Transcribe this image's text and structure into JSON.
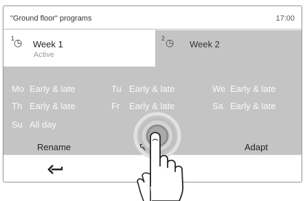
{
  "header": {
    "title": "\"Ground floor\" programs",
    "time": "17:00"
  },
  "tabs": [
    {
      "mark": "1",
      "label": "Week 1",
      "status": "Active"
    },
    {
      "mark": "2",
      "label": "Week 2"
    }
  ],
  "days": [
    {
      "day": "Mo",
      "program": "Early & late"
    },
    {
      "day": "Tu",
      "program": "Early & late"
    },
    {
      "day": "We",
      "program": "Early & late"
    },
    {
      "day": "Th",
      "program": "Early & late"
    },
    {
      "day": "Fr",
      "program": "Early & late"
    },
    {
      "day": "Sa",
      "program": "Early & late"
    },
    {
      "day": "Su",
      "program": "All day"
    }
  ],
  "actions": {
    "rename": "Rename",
    "reset": "Reset",
    "adapt": "Adapt"
  },
  "icons": {
    "clock": "clock-icon",
    "back": "back-arrow-icon",
    "touch": "finger-tap-icon"
  }
}
